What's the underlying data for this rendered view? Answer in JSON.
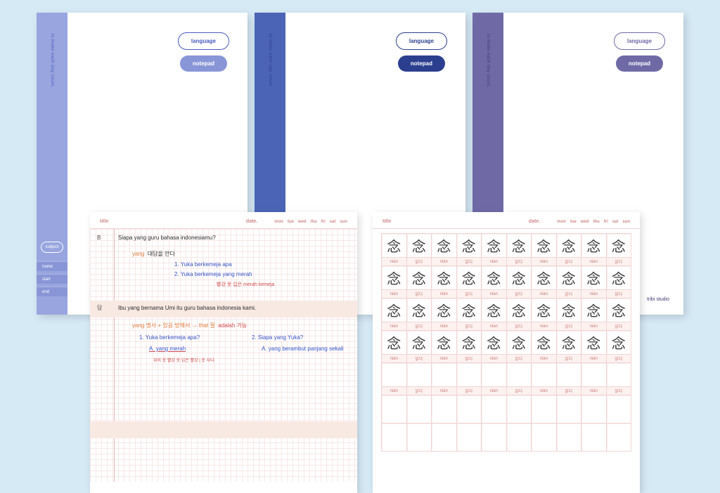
{
  "tagline": "to make each day count.",
  "badges": {
    "language": "language",
    "notepad": "notepad"
  },
  "cover1": {
    "fields": {
      "subject": "subject",
      "name": "name",
      "start": "start",
      "end": "end"
    }
  },
  "brand": "tribi studio",
  "page": {
    "title": "title",
    "date": "date.",
    "days": [
      "mon",
      "tue",
      "wed",
      "thu",
      "fri",
      "sat",
      "sun"
    ]
  },
  "notes": {
    "q": "Siapa yang guru bahasa indonesiamu?",
    "q_marker": "B",
    "ann1_kr": "대답을 안다",
    "ann1_c1": "1. Yuka berkemeja apa",
    "ann1_c2": "2. Yuka berkemeja yang merah",
    "ann1_tag": "yang",
    "ann1_small": "빨강 옷 입은 merah kemeja",
    "a_marker": "답",
    "a": "Ibu yang bernama Umi itu guru bahasa indonesia kami.",
    "ann2_head": "yang  명사 + 있음 방해서 → that 절",
    "ann2_opt": "adalah 가능",
    "r1q": "1. Yuka berkemeja apa?",
    "r1a": "A. yang merah",
    "r2q": "2. Siapa yang Yuka?",
    "r2a": "A. yang berambut panjang sekali",
    "tiny": "위의 옷 빨강 옷 입은 빨강 | 옷 사다"
  },
  "chart_data": {
    "type": "table",
    "title": "Character practice grid",
    "cols": 10,
    "char_rows": 4,
    "empty_char_rows": 1,
    "big_empty_rows": 2,
    "character": "念",
    "labels": [
      "niàn",
      "읽다"
    ]
  }
}
